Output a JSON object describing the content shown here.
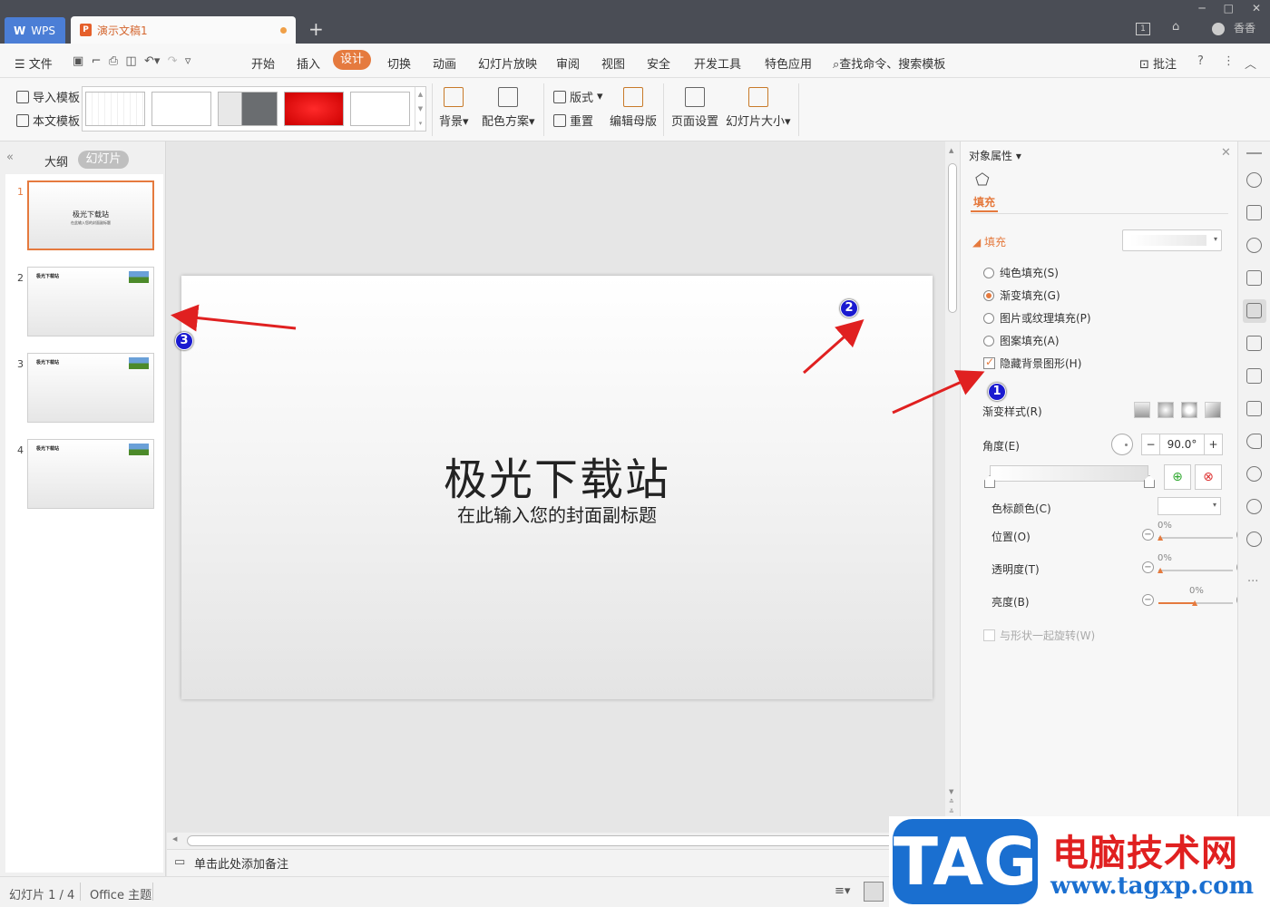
{
  "titlebar": {
    "app_tab": "WPS",
    "doc_tab": "演示文稿1",
    "user": "香香"
  },
  "menu": {
    "file": "文件",
    "items": [
      "开始",
      "插入",
      "设计",
      "切换",
      "动画",
      "幻灯片放映",
      "审阅",
      "视图",
      "安全",
      "开发工具",
      "特色应用"
    ],
    "active": "设计",
    "search": "查找命令、搜索模板",
    "comment": "批注"
  },
  "ribbon": {
    "import_template": "导入模板",
    "this_template": "本文模板",
    "background": "背景",
    "color_scheme": "配色方案",
    "layout": "版式",
    "reset": "重置",
    "edit_master": "编辑母版",
    "page_setup": "页面设置",
    "slide_size": "幻灯片大小"
  },
  "left_panel": {
    "tab_outline": "大纲",
    "tab_slides": "幻灯片",
    "slides": [
      {
        "num": "1",
        "title": "极光下载站",
        "sub": "在此输入您的封面副标题"
      },
      {
        "num": "2",
        "title": "极光下载站"
      },
      {
        "num": "3",
        "title": "极光下载站"
      },
      {
        "num": "4",
        "title": "极光下载站"
      }
    ]
  },
  "slide": {
    "title": "极光下载站",
    "subtitle": "在此输入您的封面副标题"
  },
  "notes": "单击此处添加备注",
  "right_panel": {
    "header": "对象属性",
    "tab": "填充",
    "section": "填充",
    "options": [
      "纯色填充(S)",
      "渐变填充(G)",
      "图片或纹理填充(P)",
      "图案填充(A)"
    ],
    "selected_option": "渐变填充(G)",
    "hide_bg_label": "隐藏背景图形(H)",
    "hide_bg_checked": true,
    "gradient_style": "渐变样式(R)",
    "angle_label": "角度(E)",
    "angle_value": "90.0°",
    "stop_color": "色标颜色(C)",
    "position_label": "位置(O)",
    "position_value": "0%",
    "transparency_label": "透明度(T)",
    "transparency_value": "0%",
    "brightness_label": "亮度(B)",
    "brightness_value": "0%",
    "rotate_label": "与形状一起旋转(W)"
  },
  "statusbar": {
    "slide_info": "幻灯片 1 / 4",
    "theme": "Office 主题"
  },
  "watermark": {
    "logo": "TAG",
    "cn": "电脑技术网",
    "url": "www.tagxp.com"
  },
  "annotations": [
    "1",
    "2",
    "3"
  ],
  "colors": {
    "accent": "#e57a3e",
    "wps_blue": "#4b7ed6",
    "arrow": "#e02020",
    "badge": "#1a1ad0"
  }
}
